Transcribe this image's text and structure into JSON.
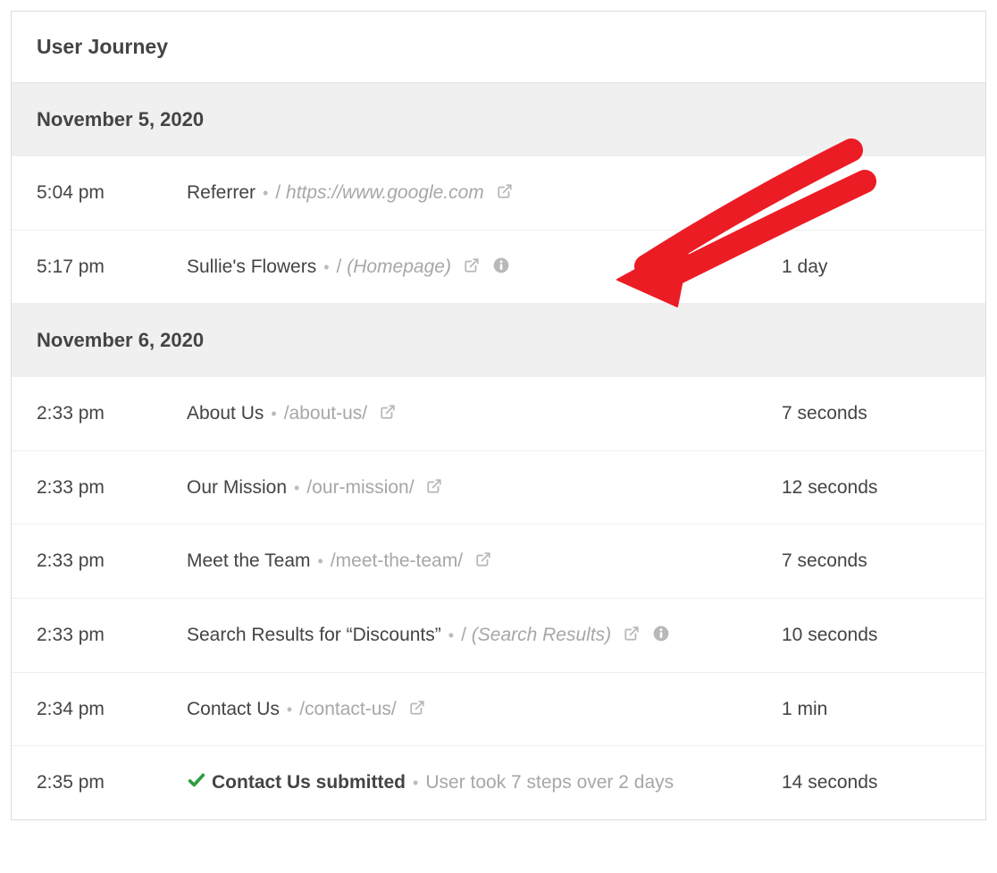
{
  "panel": {
    "title": "User Journey"
  },
  "groups": [
    {
      "date": "November 5, 2020",
      "rows": [
        {
          "time": "5:04 pm",
          "title": "Referrer",
          "path_prefix": "/",
          "path": "https://www.google.com",
          "path_italic": true,
          "ext_link": true,
          "info_icon": false,
          "duration": "",
          "check": false,
          "summary": "",
          "annotated": false
        },
        {
          "time": "5:17 pm",
          "title": "Sullie's Flowers",
          "path_prefix": "/",
          "path": "(Homepage)",
          "path_italic": true,
          "ext_link": true,
          "info_icon": true,
          "duration": "1 day",
          "check": false,
          "summary": "",
          "annotated": true
        }
      ]
    },
    {
      "date": "November 6, 2020",
      "rows": [
        {
          "time": "2:33 pm",
          "title": "About Us",
          "path_prefix": "",
          "path": "/about-us/",
          "path_italic": false,
          "ext_link": true,
          "info_icon": false,
          "duration": "7 seconds",
          "check": false,
          "summary": "",
          "annotated": false
        },
        {
          "time": "2:33 pm",
          "title": "Our Mission",
          "path_prefix": "",
          "path": "/our-mission/",
          "path_italic": false,
          "ext_link": true,
          "info_icon": false,
          "duration": "12 seconds",
          "check": false,
          "summary": "",
          "annotated": false
        },
        {
          "time": "2:33 pm",
          "title": "Meet the Team",
          "path_prefix": "",
          "path": "/meet-the-team/",
          "path_italic": false,
          "ext_link": true,
          "info_icon": false,
          "duration": "7 seconds",
          "check": false,
          "summary": "",
          "annotated": false
        },
        {
          "time": "2:33 pm",
          "title": "Search Results for “Discounts”",
          "path_prefix": "/",
          "path": "(Search Results)",
          "path_italic": true,
          "ext_link": true,
          "info_icon": true,
          "duration": "10 seconds",
          "check": false,
          "summary": "",
          "annotated": false
        },
        {
          "time": "2:34 pm",
          "title": "Contact Us",
          "path_prefix": "",
          "path": "/contact-us/",
          "path_italic": false,
          "ext_link": true,
          "info_icon": false,
          "duration": "1 min",
          "check": false,
          "summary": "",
          "annotated": false
        },
        {
          "time": "2:35 pm",
          "title": "Contact Us submitted",
          "path_prefix": "",
          "path": "",
          "path_italic": false,
          "ext_link": false,
          "info_icon": false,
          "duration": "14 seconds",
          "check": true,
          "summary": "User took 7 steps over 2 days",
          "annotated": false
        }
      ]
    }
  ]
}
